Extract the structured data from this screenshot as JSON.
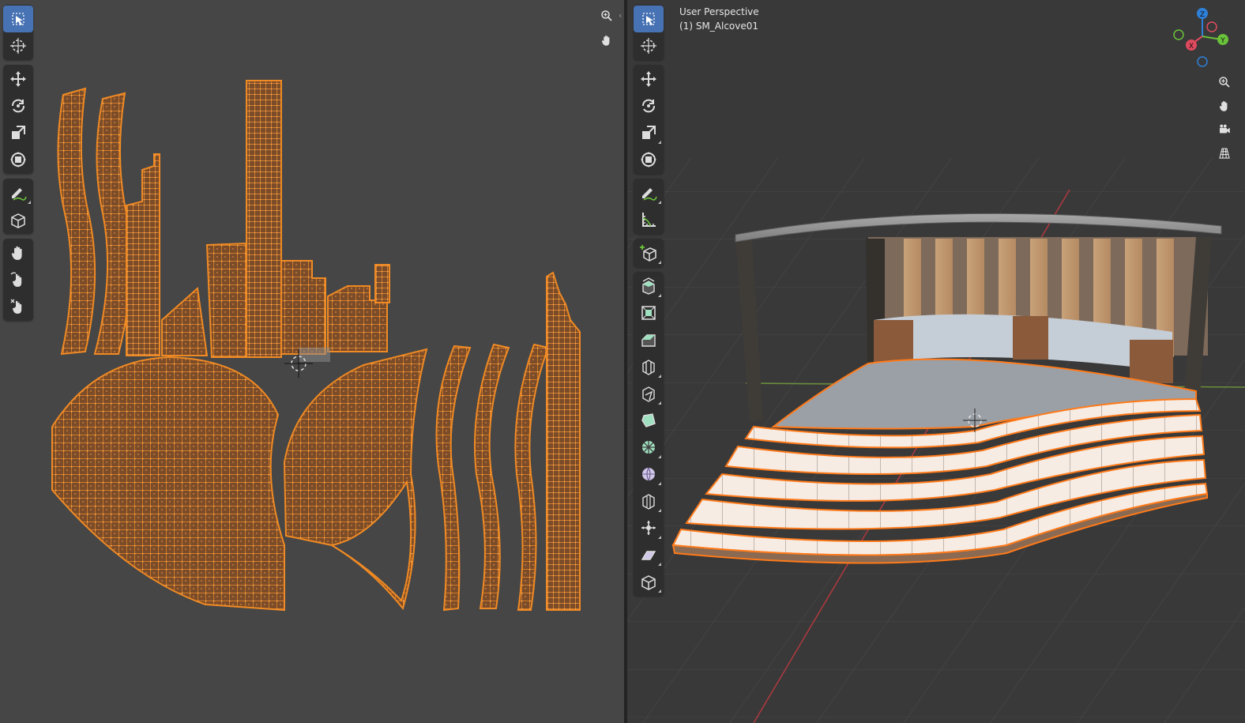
{
  "uv_editor": {
    "toolbar": {
      "groups": [
        [
          {
            "name": "select-box-tool",
            "icon": "select-box-icon",
            "active": true
          },
          {
            "name": "cursor-tool",
            "icon": "cursor-icon",
            "active": false
          }
        ],
        [
          {
            "name": "move-tool",
            "icon": "move-icon",
            "active": false
          },
          {
            "name": "rotate-tool",
            "icon": "rotate-icon",
            "active": false
          },
          {
            "name": "scale-tool",
            "icon": "scale-icon",
            "active": false
          },
          {
            "name": "transform-tool",
            "icon": "transform-icon",
            "active": false
          }
        ],
        [
          {
            "name": "annotate-tool",
            "icon": "annotate-icon",
            "active": false,
            "corner": true
          },
          {
            "name": "rip-region-tool",
            "icon": "rip-region-icon",
            "active": false
          }
        ],
        [
          {
            "name": "grab-tool",
            "icon": "grab-icon",
            "active": false
          },
          {
            "name": "relax-tool",
            "icon": "relax-icon",
            "active": false
          },
          {
            "name": "pinch-tool",
            "icon": "pinch-icon",
            "active": false
          }
        ]
      ]
    },
    "nav": [
      {
        "name": "zoom-view-button",
        "icon": "zoom-icon"
      },
      {
        "name": "pan-view-button",
        "icon": "hand-icon"
      }
    ]
  },
  "viewport": {
    "header": {
      "view_name": "User Perspective",
      "object_name": "(1) SM_Alcove01"
    },
    "toolbar": {
      "groups": [
        [
          {
            "name": "select-box-tool",
            "icon": "select-box-icon",
            "active": true
          },
          {
            "name": "cursor-tool",
            "icon": "cursor-icon",
            "active": false
          }
        ],
        [
          {
            "name": "move-tool",
            "icon": "move-icon",
            "active": false
          },
          {
            "name": "rotate-tool",
            "icon": "rotate-icon",
            "active": false
          },
          {
            "name": "scale-tool",
            "icon": "scale-icon",
            "active": false,
            "corner": true
          },
          {
            "name": "transform-tool",
            "icon": "transform-icon",
            "active": false
          }
        ],
        [
          {
            "name": "annotate-tool",
            "icon": "annotate-icon",
            "active": false,
            "corner": true
          },
          {
            "name": "measure-tool",
            "icon": "measure-icon",
            "active": false
          }
        ],
        [
          {
            "name": "add-cube-tool",
            "icon": "add-cube-icon",
            "active": false,
            "corner": true
          }
        ],
        [
          {
            "name": "extrude-region-tool",
            "icon": "extrude-icon",
            "active": false,
            "corner": true
          },
          {
            "name": "inset-faces-tool",
            "icon": "inset-icon",
            "active": false
          },
          {
            "name": "bevel-tool",
            "icon": "bevel-icon",
            "active": false
          },
          {
            "name": "loop-cut-tool",
            "icon": "loop-cut-icon",
            "active": false,
            "corner": true
          },
          {
            "name": "knife-tool",
            "icon": "knife-icon",
            "active": false,
            "corner": true
          },
          {
            "name": "poly-build-tool",
            "icon": "poly-build-icon",
            "active": false
          },
          {
            "name": "spin-tool",
            "icon": "spin-icon",
            "active": false,
            "corner": true
          },
          {
            "name": "smooth-tool",
            "icon": "smooth-icon",
            "active": false,
            "corner": true
          },
          {
            "name": "edge-slide-tool",
            "icon": "edge-slide-icon",
            "active": false,
            "corner": true
          },
          {
            "name": "shrink-fatten-tool",
            "icon": "shrink-fatten-icon",
            "active": false,
            "corner": true
          },
          {
            "name": "shear-tool",
            "icon": "shear-icon",
            "active": false,
            "corner": true
          },
          {
            "name": "rip-region-tool",
            "icon": "rip-region-icon",
            "active": false,
            "corner": true
          }
        ]
      ]
    },
    "gizmo": {
      "axes": [
        {
          "label": "Z",
          "color": "#2f80d8"
        },
        {
          "label": "Y",
          "color": "#6ac23a"
        },
        {
          "label": "X",
          "color": "#e04a5f"
        }
      ]
    },
    "nav": [
      {
        "name": "zoom-view-button",
        "icon": "zoom-icon"
      },
      {
        "name": "pan-view-button",
        "icon": "hand-icon"
      },
      {
        "name": "camera-view-button",
        "icon": "camera-icon"
      },
      {
        "name": "ortho-toggle-button",
        "icon": "grid-icon"
      }
    ]
  },
  "colors": {
    "accent": "#4772b3",
    "uv_orange": "#f08a24",
    "selection": "#ff7a1a"
  }
}
